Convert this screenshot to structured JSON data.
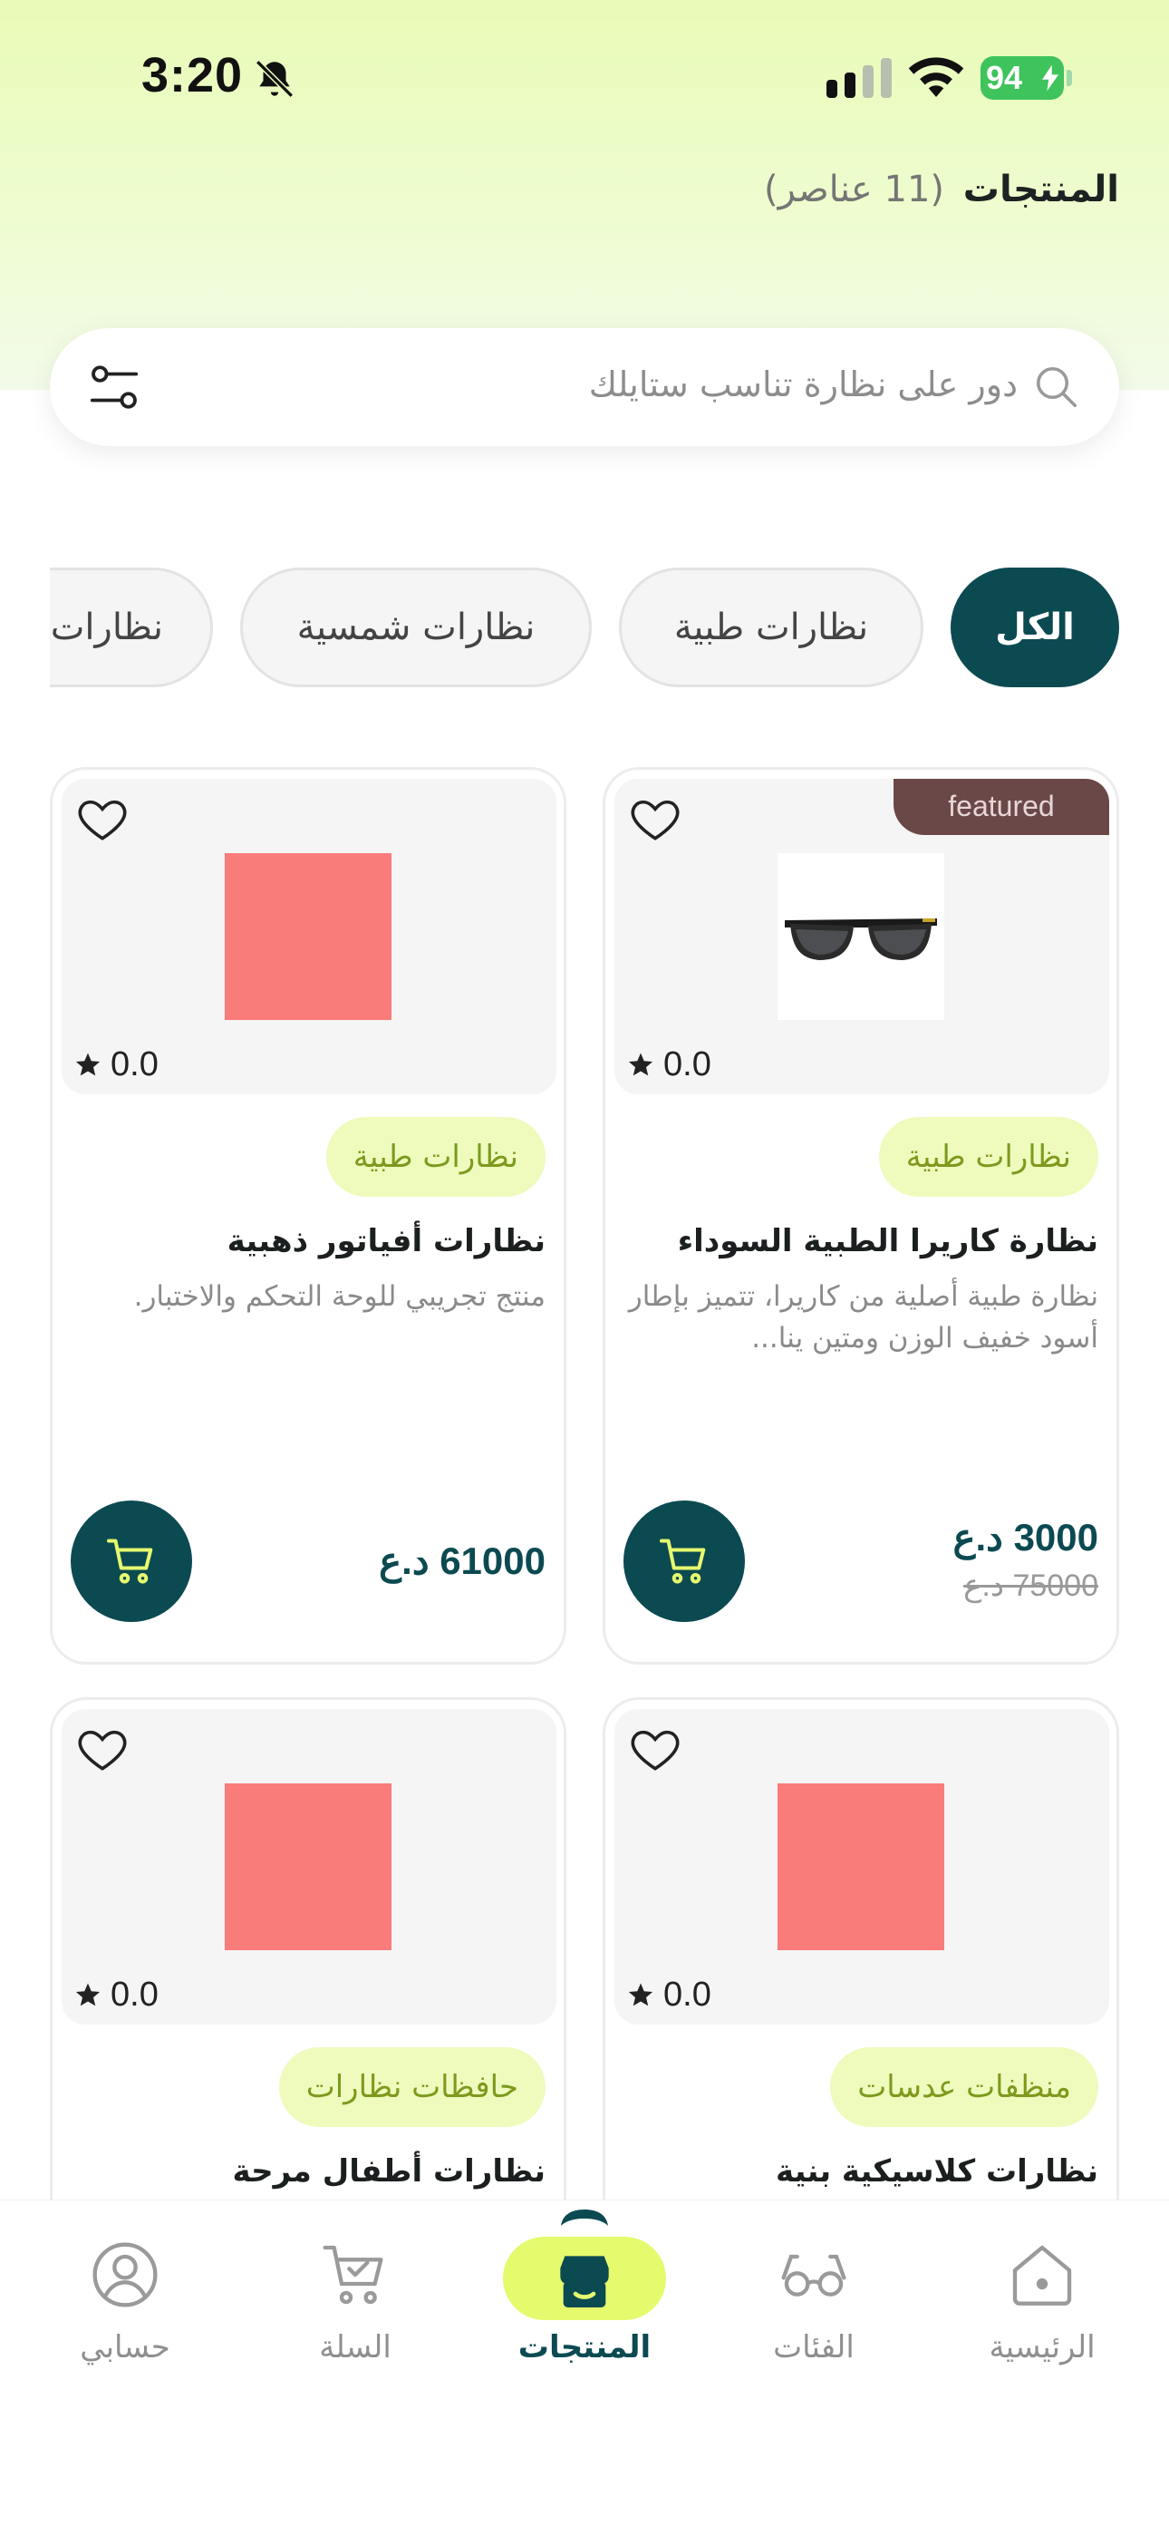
{
  "status_bar": {
    "time": "3:20",
    "battery": "94"
  },
  "header": {
    "title": "المنتجات",
    "count": "(11 عناصر)"
  },
  "search": {
    "placeholder": "دور على نظارة تناسب ستايلك"
  },
  "categories": [
    {
      "label": "الكل",
      "active": true
    },
    {
      "label": "نظارات طبية",
      "active": false
    },
    {
      "label": "نظارات شمسية",
      "active": false
    },
    {
      "label": "نظارات رياضية",
      "active": false
    }
  ],
  "products": [
    {
      "badge": "featured",
      "rating": "0.0",
      "category": "نظارات طبية",
      "name": "نظارة كاريرا الطبية السوداء",
      "description": "نظارة طبية أصلية من كاريرا، تتميز بإطار أسود خفيف الوزن ومتين ينا...",
      "price": "3000 د.ع",
      "old_price": "75000 د.ع",
      "image": "sunglasses-photo"
    },
    {
      "badge": "",
      "rating": "0.0",
      "category": "نظارات طبية",
      "name": "نظارات أفياتور ذهبية",
      "description": "منتج تجريبي للوحة التحكم والاختبار.",
      "price": "61000 د.ع",
      "old_price": "",
      "image": "placeholder"
    },
    {
      "badge": "",
      "rating": "0.0",
      "category": "منظفات عدسات",
      "name": "نظارات كلاسيكية بنية",
      "description": "",
      "price": "",
      "old_price": "",
      "image": "placeholder"
    },
    {
      "badge": "",
      "rating": "0.0",
      "category": "حافظات نظارات",
      "name": "نظارات أطفال مرحة",
      "description": "",
      "price": "",
      "old_price": "",
      "image": "placeholder"
    }
  ],
  "bottom_nav": [
    {
      "label": "الرئيسية",
      "icon": "home-icon",
      "active": false
    },
    {
      "label": "الفئات",
      "icon": "glasses-icon",
      "active": false
    },
    {
      "label": "المنتجات",
      "icon": "store-icon",
      "active": true
    },
    {
      "label": "السلة",
      "icon": "cart-icon",
      "active": false
    },
    {
      "label": "حسابي",
      "icon": "user-icon",
      "active": false
    }
  ],
  "colors": {
    "primary": "#0c4a51",
    "accent": "#e6fa6e",
    "pill_bg": "#eefbbd",
    "pill_text": "#7d9a1d",
    "badge": "#6b4848",
    "placeholder": "#f97c7a"
  }
}
